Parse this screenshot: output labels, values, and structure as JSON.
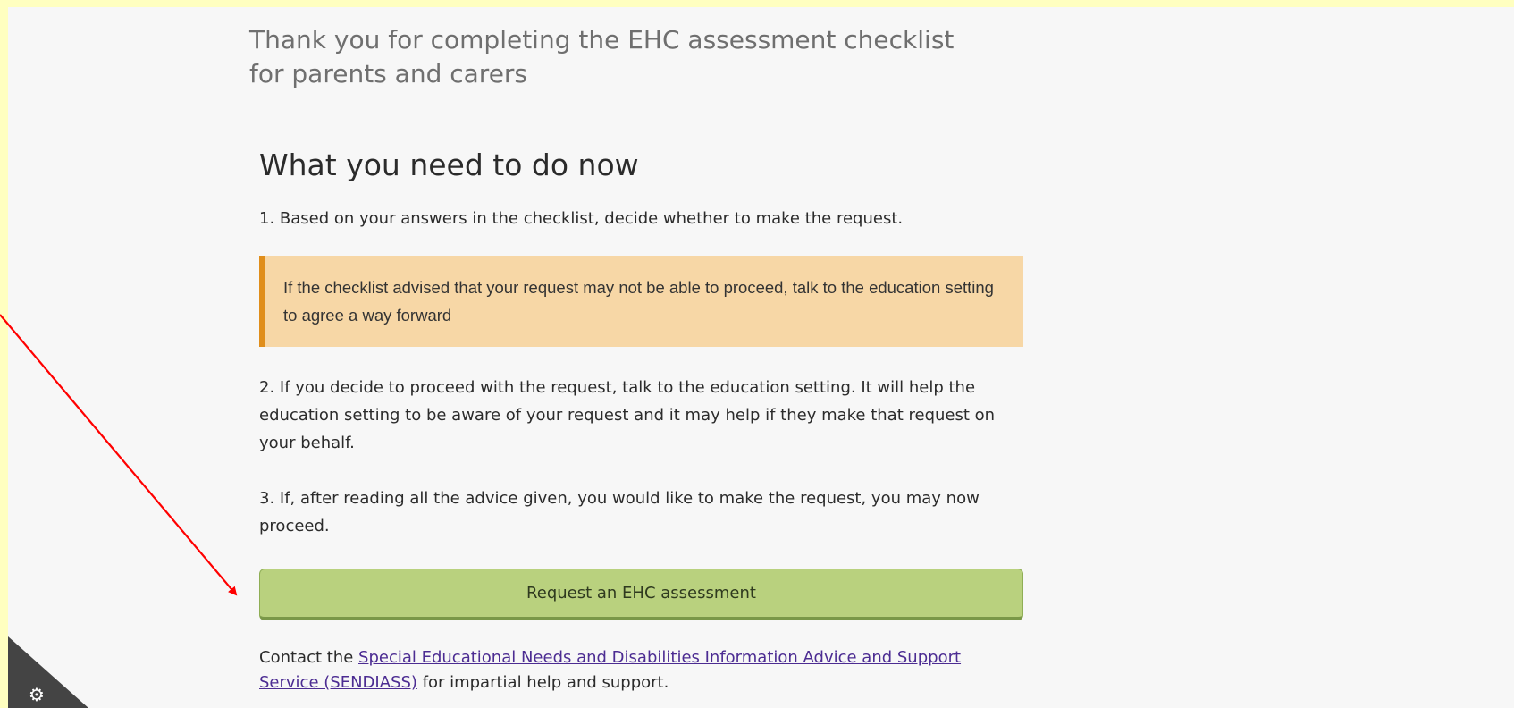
{
  "heading": {
    "thanks": "Thank you for completing the EHC assessment checklist for parents and carers"
  },
  "section": {
    "title": "What you need to do now",
    "step1": "1. Based on your answers in the checklist, decide whether to make the request.",
    "warning": "If the checklist advised that your request may not be able to proceed, talk to the education setting to agree a way forward",
    "step2": "2. If you decide to proceed with the request, talk to the education setting. It will help the education setting to be aware of your request and it may help if they make that request on your behalf.",
    "step3": "3. If, after reading all the advice given, you would like to make the request, you may now proceed.",
    "button_label": "Request an EHC assessment",
    "contact_prefix": "Contact the ",
    "contact_link": "Special Educational Needs and Disabilities Information Advice and Support Service (SENDIASS)",
    "contact_suffix": " for impartial help and support."
  },
  "icons": {
    "corner": "gear-icon",
    "annotation": "red-arrow"
  },
  "colors": {
    "highlight_border": "#ffffc0",
    "warning_bg": "#f7d7a6",
    "warning_accent": "#e08e1b",
    "button_bg": "#b9d17e",
    "link": "#4c2c92",
    "annotation_arrow": "#ff0000"
  }
}
